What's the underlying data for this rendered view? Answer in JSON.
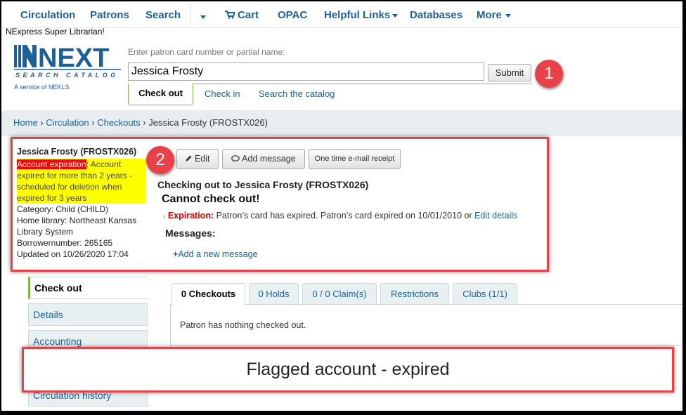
{
  "nav": {
    "items": [
      "Circulation",
      "Patrons",
      "Search"
    ],
    "cart": "Cart",
    "opac": "OPAC",
    "helpful_links": "Helpful Links",
    "databases": "Databases",
    "more": "More"
  },
  "logged_in_user": "NExpress Super Librarian!",
  "logo": {
    "main": "NEXT",
    "sub": "SEARCH CATALOG",
    "tagline": "A service of NEKLS"
  },
  "search": {
    "hint": "Enter patron card number or partial name:",
    "value": "Jessica Frosty",
    "submit": "Submit",
    "tabs": [
      "Check out",
      "Check in",
      "Search the catalog"
    ]
  },
  "breadcrumb": {
    "home": "Home",
    "circulation": "Circulation",
    "checkouts": "Checkouts",
    "current": "Jessica Frosty (FROSTX026)"
  },
  "patron": {
    "name": "Jessica Frosty (FROSTX026)",
    "flag_label": "Account expiration",
    "flag_text": ": Account expired for more than 2 years - scheduled for deletion when expired for 3 years",
    "category": "Category: Child (CHILD)",
    "home_library": "Home library: Northeast Kansas Library System",
    "borrowernumber": "Borrowernumber: 265165",
    "updated": "Updated on 10/26/2020 17:04"
  },
  "left_menu": [
    "Check out",
    "Details",
    "Accounting",
    "Circulation history"
  ],
  "toolbar": {
    "edit": "Edit",
    "add_message": "Add message",
    "email_receipt": "One time e-mail receipt"
  },
  "main": {
    "checking_out": "Checking out to Jessica Frosty (FROSTX026)",
    "cannot": "Cannot check out!",
    "expiration_label": "Expiration:",
    "expiration_text": "Patron's card has expired. Patron's card expired on 10/01/2010 or",
    "edit_details": "Edit details",
    "messages": "Messages:",
    "add_new_message": "Add a new message"
  },
  "circ_tabs": [
    "0 Checkouts",
    "0 Holds",
    "0 / 0 Claim(s)",
    "Restrictions",
    "Clubs (1/1)"
  ],
  "nothing_checked_out": "Patron has nothing checked out.",
  "annotations": {
    "badge1": "1",
    "badge2": "2",
    "caption": "Flagged account - expired"
  },
  "colors": {
    "link": "#1d5f99",
    "annotation_red": "#e8414a",
    "flag_yellow": "#ffff00",
    "flag_red": "#ff0000",
    "accent_green": "#88b64a"
  }
}
